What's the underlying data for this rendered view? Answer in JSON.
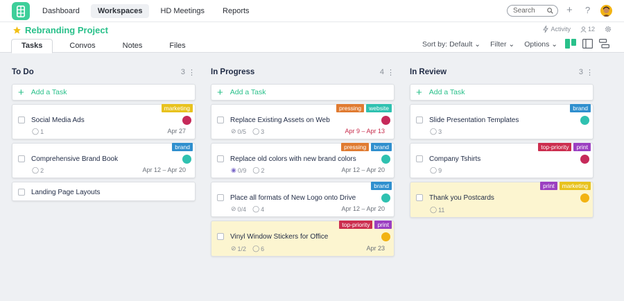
{
  "nav": [
    "Dashboard",
    "Workspaces",
    "HD Meetings",
    "Reports"
  ],
  "search": {
    "placeholder": "Search"
  },
  "project": {
    "title": "Rebranding Project",
    "activity": "Activity",
    "members": "12"
  },
  "tabs": [
    "Tasks",
    "Convos",
    "Notes",
    "Files"
  ],
  "controls": {
    "sort": "Sort by: Default",
    "filter": "Filter",
    "options": "Options"
  },
  "colors": {
    "accent": "#29c08a",
    "marketing": "#e8c21e",
    "brand": "#2f8fce",
    "pressing": "#e07b31",
    "website": "#2fc1b0",
    "toppriority": "#cc2e4f",
    "print": "#9b3fc1",
    "highlight": "#fcf5d0"
  },
  "add_task": "Add a Task",
  "columns": [
    {
      "title": "To Do",
      "count": "3",
      "tasks": [
        {
          "title": "Social Media Ads",
          "tags": [
            {
              "label": "marketing",
              "color": "#e8c21e"
            }
          ],
          "comments": "1",
          "date": "Apr 27"
        },
        {
          "title": "Comprehensive Brand Book",
          "tags": [
            {
              "label": "brand",
              "color": "#2f8fce"
            }
          ],
          "comments": "2",
          "date": "Apr 12 – Apr 20"
        },
        {
          "title": "Landing Page Layouts"
        }
      ]
    },
    {
      "title": "In Progress",
      "count": "4",
      "tasks": [
        {
          "title": "Replace Existing Assets on Web",
          "tags": [
            {
              "label": "pressing",
              "color": "#e07b31"
            },
            {
              "label": "website",
              "color": "#2fc1b0"
            }
          ],
          "checklist": "0/5",
          "comments": "3",
          "date": "Apr 9 – Apr 13"
        },
        {
          "title": "Replace old colors with new brand colors",
          "tags": [
            {
              "label": "pressing",
              "color": "#e07b31"
            },
            {
              "label": "brand",
              "color": "#2f8fce"
            }
          ],
          "checklist": "0/9",
          "comments": "2",
          "date": "Apr 12 – Apr 20"
        },
        {
          "title": "Place all formats of New Logo onto Drive",
          "tags": [
            {
              "label": "brand",
              "color": "#2f8fce"
            }
          ],
          "checklist": "0/4",
          "comments": "4",
          "date": "Apr 12 – Apr 20"
        },
        {
          "title": "Vinyl Window Stickers for Office",
          "tags": [
            {
              "label": "top-priority",
              "color": "#cc2e4f"
            },
            {
              "label": "print",
              "color": "#9b3fc1"
            }
          ],
          "checklist": "1/2",
          "comments": "6",
          "date": "Apr 23"
        }
      ]
    },
    {
      "title": "In Review",
      "count": "3",
      "tasks": [
        {
          "title": "Slide Presentation Templates",
          "tags": [
            {
              "label": "brand",
              "color": "#2f8fce"
            }
          ],
          "comments": "3"
        },
        {
          "title": "Company Tshirts",
          "tags": [
            {
              "label": "top-priority",
              "color": "#cc2e4f"
            },
            {
              "label": "print",
              "color": "#9b3fc1"
            }
          ],
          "comments": "9"
        },
        {
          "title": "Thank you Postcards",
          "tags": [
            {
              "label": "print",
              "color": "#9b3fc1"
            },
            {
              "label": "marketing",
              "color": "#e8c21e"
            }
          ],
          "comments": "11"
        }
      ]
    }
  ]
}
